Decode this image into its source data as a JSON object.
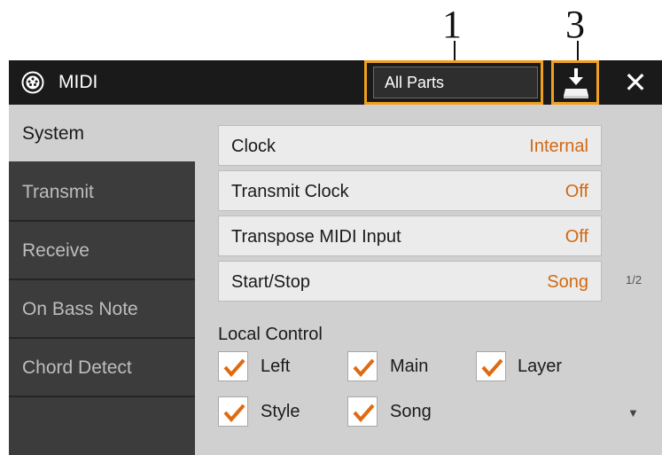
{
  "callouts": [
    "1",
    "3"
  ],
  "header": {
    "title": "MIDI",
    "icon": "midi-icon",
    "part_selector_value": "All Parts",
    "save_icon": "save-icon",
    "close_symbol": "✕"
  },
  "sidebar": {
    "tabs": [
      {
        "label": "System",
        "active": true
      },
      {
        "label": "Transmit",
        "active": false
      },
      {
        "label": "Receive",
        "active": false
      },
      {
        "label": "On Bass Note",
        "active": false
      },
      {
        "label": "Chord Detect",
        "active": false
      }
    ]
  },
  "settings": [
    {
      "label": "Clock",
      "value": "Internal"
    },
    {
      "label": "Transmit Clock",
      "value": "Off"
    },
    {
      "label": "Transpose MIDI Input",
      "value": "Off"
    },
    {
      "label": "Start/Stop",
      "value": "Song"
    }
  ],
  "page_indicator": "1/2",
  "local_control": {
    "label": "Local Control",
    "checkboxes": [
      {
        "label": "Left",
        "checked": true
      },
      {
        "label": "Main",
        "checked": true
      },
      {
        "label": "Layer",
        "checked": true
      },
      {
        "label": "Style",
        "checked": true
      },
      {
        "label": "Song",
        "checked": true
      }
    ]
  },
  "scroll_down_symbol": "▼",
  "colors": {
    "accent_value": "#d06a14",
    "callout_frame": "#f0a020",
    "checkmark": "#e06a10"
  }
}
